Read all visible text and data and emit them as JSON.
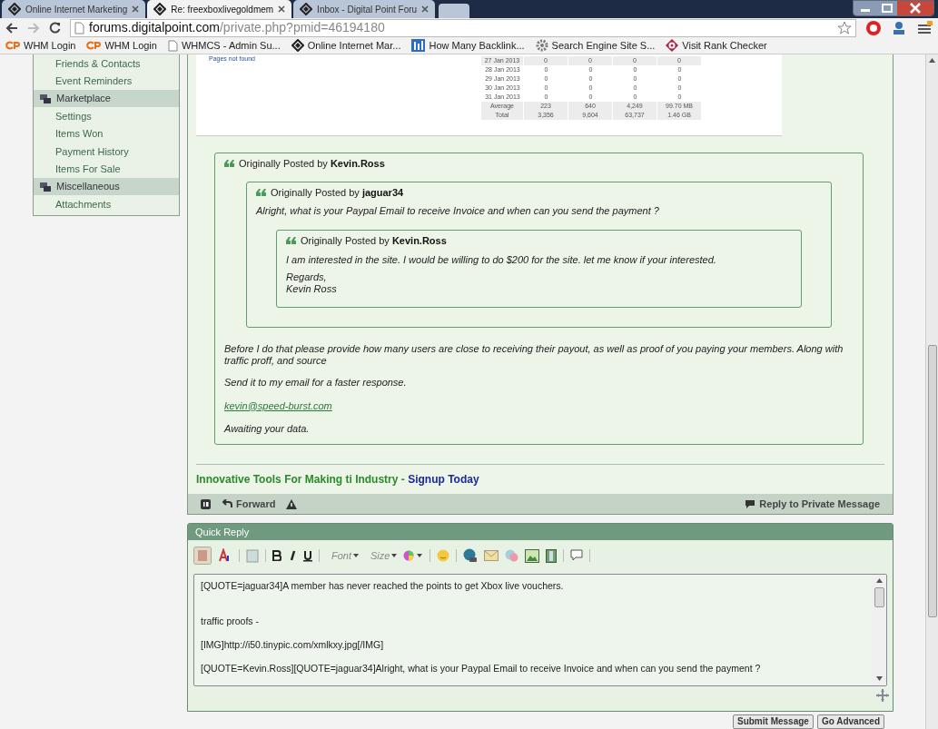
{
  "browser": {
    "tabs": [
      {
        "title": "Online Internet Marketing",
        "selected": false
      },
      {
        "title": "Re: freexboxlivegoldmem",
        "selected": true
      },
      {
        "title": "Inbox - Digital Point Foru",
        "selected": false
      }
    ],
    "url_host": "forums.digitalpoint.com",
    "url_path": "/private.php?pmid=46194180",
    "bookmarks": [
      {
        "kind": "cpanel",
        "label": "WHM Login"
      },
      {
        "kind": "cpanel",
        "label": "WHM Login"
      },
      {
        "kind": "page",
        "label": "WHMCS - Admin Su..."
      },
      {
        "kind": "dp",
        "label": "Online Internet Mar..."
      },
      {
        "kind": "chart",
        "label": "How Many Backlink..."
      },
      {
        "kind": "gear",
        "label": "Search Engine Site S..."
      },
      {
        "kind": "target",
        "label": "Visit Rank Checker"
      }
    ]
  },
  "sidebar": {
    "items": [
      {
        "kind": "link",
        "label": "Friends & Contacts"
      },
      {
        "kind": "link",
        "label": "Event Reminders"
      },
      {
        "kind": "header",
        "label": "Marketplace"
      },
      {
        "kind": "link",
        "label": "Settings"
      },
      {
        "kind": "link",
        "label": "Items Won"
      },
      {
        "kind": "link",
        "label": "Payment History"
      },
      {
        "kind": "link",
        "label": "Items For Sale"
      },
      {
        "kind": "header",
        "label": "Miscellaneous"
      },
      {
        "kind": "link",
        "label": "Attachments"
      }
    ]
  },
  "stats_image": {
    "link": "Pages not found",
    "rows": [
      [
        "27 Jan 2013",
        "0",
        "0",
        "0",
        "0"
      ],
      [
        "28 Jan 2013",
        "0",
        "0",
        "0",
        "0"
      ],
      [
        "29 Jan 2013",
        "0",
        "0",
        "0",
        "0"
      ],
      [
        "30 Jan 2013",
        "0",
        "0",
        "0",
        "0"
      ],
      [
        "31 Jan 2013",
        "0",
        "0",
        "0",
        "0"
      ],
      [
        "Average",
        "223",
        "640",
        "4,249",
        "99.70 MB"
      ],
      [
        "Total",
        "3,356",
        "9,604",
        "63,737",
        "1.46 GB"
      ]
    ]
  },
  "quote": {
    "prefix": "Originally Posted by",
    "author": "Kevin.Ross",
    "quote": {
      "prefix": "Originally Posted by",
      "author": "jaguar34",
      "quote": {
        "prefix": "Originally Posted by",
        "author": "Kevin.Ross",
        "paragraphs": [
          {
            "kind": "text",
            "text": "I am interested in the site. I would be willing to do $200 for the site. let me know if your interested."
          },
          {
            "kind": "text",
            "text": "Regards,\nKevin Ross"
          }
        ]
      },
      "paragraphs": [
        {
          "kind": "text",
          "text": "Alright, what is your Paypal Email to receive Invoice and when can you send the payment ?"
        }
      ]
    },
    "paragraphs": [
      {
        "kind": "text",
        "text": "Before I do that please provide how many users are close to receiving their payout, as well as proof of you paying your members. Along with traffic proff, and source"
      },
      {
        "kind": "text",
        "text": "Send it to my email for a faster response."
      },
      {
        "kind": "link",
        "text": "kevin@speed-burst.com"
      },
      {
        "kind": "text",
        "text": "Awaiting your data."
      }
    ]
  },
  "signature": {
    "text": "Innovative Tools For Making ti Industry - ",
    "link": "Signup Today"
  },
  "post_footer": {
    "forward": "Forward",
    "reply": "Reply to Private Message"
  },
  "quick_reply": {
    "title": "Quick Reply",
    "font": "Font",
    "size": "Size",
    "message": "[QUOTE=jaguar34]A member has never reached the points to get Xbox live vouchers.\n\n\ntraffic proofs -\n\n[IMG]http://i50.tinypic.com/xmlkxy.jpg[/IMG]\n\n[QUOTE=Kevin.Ross][QUOTE=jaguar34]Alright, what is your Paypal Email to receive Invoice and when can you send the payment ?",
    "buttons": [
      "Submit Message",
      "Go Advanced"
    ]
  }
}
